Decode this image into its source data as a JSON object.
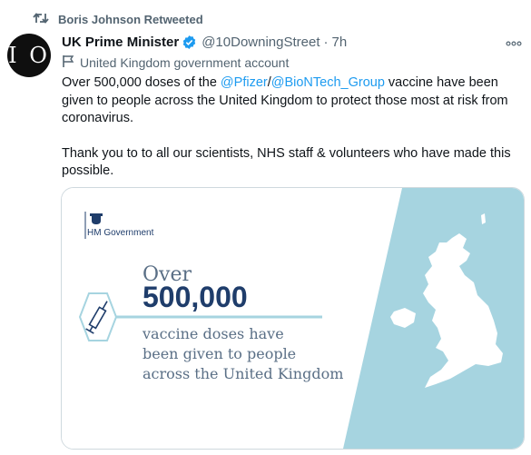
{
  "retweet": {
    "text": "Boris Johnson Retweeted",
    "icon": "retweet-icon"
  },
  "author": {
    "avatar_text": "I O",
    "name": "UK Prime Minister",
    "handle": "@10DowningStreet",
    "separator": "·",
    "time": "7h",
    "verified": true
  },
  "account_label": {
    "text": "United Kingdom government account",
    "icon": "flag-icon"
  },
  "tweet": {
    "line1_before": "Over 500,000 doses of the ",
    "mention1": "@Pfizer",
    "slash": "/",
    "mention2": "@BioNTech_Group",
    "line1_after": " vaccine have been given to people across the United Kingdom to protect those most at risk from coronavirus.",
    "paragraph2": "Thank you to to all our scientists, NHS staff & volunteers who have made this possible."
  },
  "card": {
    "logo_text": "HM Government",
    "over": "Over",
    "number": "500,000",
    "line1": "vaccine doses have",
    "line2": "been given to people",
    "line3": "across the United Kingdom"
  },
  "colors": {
    "accent": "#1d9bf0",
    "muted": "#536471",
    "card_navy": "#1f3d6b",
    "card_teal": "#a6d4e0",
    "text_gray": "#5a6f86"
  }
}
